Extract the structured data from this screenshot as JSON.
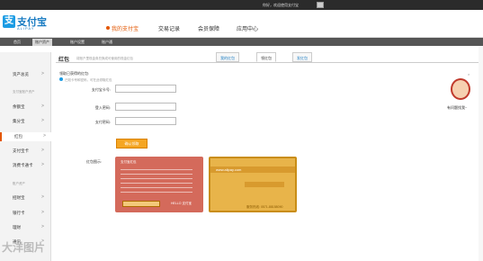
{
  "topbar": {
    "greeting": "你好，欢迎使用支付宝",
    "msg_icon": "message-icon"
  },
  "logo": {
    "cn": "支付宝",
    "en": "ALIPAY",
    "mark": "支"
  },
  "mainnav": {
    "items": [
      "我的支付宝",
      "交易记录",
      "会员保障",
      "应用中心"
    ],
    "active_index": 0
  },
  "subnav": {
    "items": [
      "首页",
      "账户资产",
      "账户设置",
      "账户通"
    ],
    "active_index": 1
  },
  "sidebar": {
    "items": [
      {
        "label": "资产总览",
        "chevron": ">"
      },
      {
        "label": "支付宝账户资产",
        "section": true
      },
      {
        "label": "余额宝",
        "chevron": ">"
      },
      {
        "label": "集分宝",
        "chevron": ">"
      },
      {
        "label": "红包",
        "chevron": ">",
        "active": true
      },
      {
        "label": "支付宝卡",
        "chevron": ">"
      },
      {
        "label": "消费卡通卡",
        "chevron": ">"
      },
      {
        "label": "账户资产",
        "section": true
      },
      {
        "label": "招财宝",
        "chevron": ">"
      },
      {
        "label": "银行卡",
        "chevron": ">"
      },
      {
        "label": "理财",
        "chevron": ">"
      },
      {
        "label": "通讯",
        "chevron": ">"
      }
    ]
  },
  "content": {
    "title": "红包",
    "desc": "将账户里现金券兑换成可使用的现金红包",
    "tabs": [
      "我的红包",
      "领红包",
      "发红包"
    ],
    "active_tab": 1
  },
  "form": {
    "hint": "领取已获得的红包:",
    "subhint": "已知卡号和密码，可在此领取红包",
    "card_label": "支付宝卡号:",
    "login_label": "登入密码:",
    "pay_label": "支付密码:",
    "confirm": "确认领取",
    "sample_label": "红包图示:"
  },
  "cards": {
    "front_title": "支付宝红包",
    "back_url": "www.alipay.com",
    "back_phone": "服务热线: 0571-88158090",
    "brand": "HELLO 支付宝"
  },
  "side_widget": {
    "help": "有问题找我~",
    "close": "×"
  },
  "watermark": "大洋图片"
}
